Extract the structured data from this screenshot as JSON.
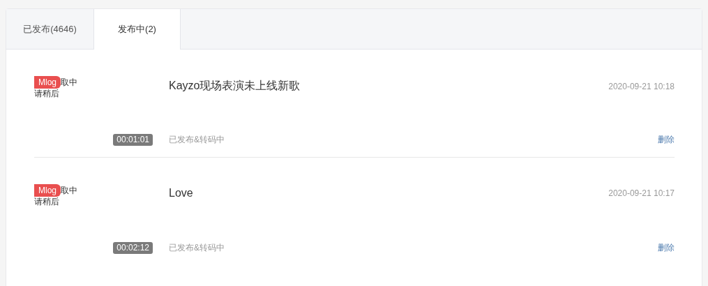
{
  "tabs": [
    {
      "label": "已发布(4646)",
      "selected": false
    },
    {
      "label": "发布中(2)",
      "selected": true
    }
  ],
  "items": [
    {
      "badge": "Mlog",
      "cover_text_1": "取中",
      "cover_text_2": "请稍后",
      "duration": "00:01:01",
      "title": "Kayzo现场表演未上线新歌",
      "time": "2020-09-21 10:18",
      "status": "已发布&转码中",
      "action": "删除"
    },
    {
      "badge": "Mlog",
      "cover_text_1": "取中",
      "cover_text_2": "请稍后",
      "duration": "00:02:12",
      "title": "Love",
      "time": "2020-09-21 10:17",
      "status": "已发布&转码中",
      "action": "删除"
    }
  ]
}
